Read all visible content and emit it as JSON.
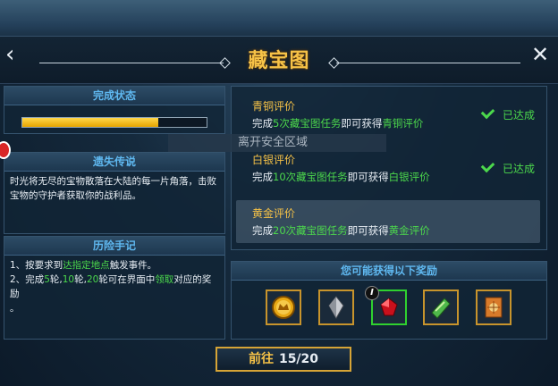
{
  "header": {
    "title": "藏宝图",
    "back_icon": "chevron-left-icon",
    "close_icon": "close-icon"
  },
  "left": {
    "status": {
      "heading": "完成状态",
      "progress": 0.74
    },
    "legend": {
      "heading": "遗失传说",
      "text": "时光将无尽的宝物散落在大陆的每一片角落，击败宝物的守护者获取你的战利品。"
    },
    "notes": {
      "heading": "历险手记",
      "line1": {
        "prefix": "1、按要求到",
        "link": "达指定地点",
        "suffix": "触发事件。"
      },
      "line2": {
        "p1": "2、完成",
        "n1": "5",
        "s1": "轮,",
        "n2": "10",
        "s2": "轮,",
        "n3": "20",
        "p2": "轮可在界面中",
        "link": "领取",
        "p3": "对应的奖励",
        "tail": "。"
      }
    }
  },
  "ratings": [
    {
      "label": "青铜评价",
      "pre": "完成",
      "count": "5次藏宝图任务",
      "mid": "即可获得",
      "reward": "青铜评价",
      "status": "已达成"
    },
    {
      "label": "白银评价",
      "pre": "完成",
      "count": "10次藏宝图任务",
      "mid": "即可获得",
      "reward": "白银评价",
      "status": "已达成"
    },
    {
      "label": "黄金评价",
      "pre": "完成",
      "count": "20次藏宝图任务",
      "mid": "即可获得",
      "reward": "黄金评价",
      "status": ""
    }
  ],
  "rewards": {
    "heading": "您可能获得以下奖励",
    "items": [
      "gold-coin-icon",
      "silver-crystal-icon",
      "red-gem-icon",
      "green-scroll-icon",
      "treasure-card-icon"
    ],
    "info_label": "I"
  },
  "toast": {
    "text": "离开安全区域"
  },
  "go_button": {
    "label": "前往",
    "count": "15/20"
  },
  "colors": {
    "gold": "#f6c247",
    "green": "#4cd84c",
    "blue_heading": "#5fb8f0"
  }
}
